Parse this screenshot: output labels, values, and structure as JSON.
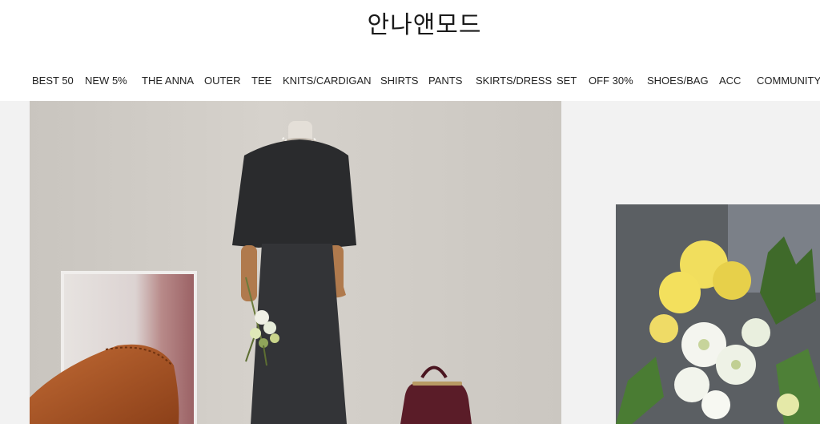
{
  "header": {
    "logo_text": "안나앤모드"
  },
  "nav": {
    "items": [
      {
        "label": "BEST 50",
        "name": "nav-item-best50"
      },
      {
        "label": "NEW 5%",
        "name": "nav-item-new5"
      },
      {
        "label": "THE ANNA",
        "name": "nav-item-the-anna"
      },
      {
        "label": "OUTER",
        "name": "nav-item-outer"
      },
      {
        "label": "TEE",
        "name": "nav-item-tee"
      },
      {
        "label": "KNITS/CARDIGAN",
        "name": "nav-item-knits-cardigan"
      },
      {
        "label": "SHIRTS",
        "name": "nav-item-shirts"
      },
      {
        "label": "PANTS",
        "name": "nav-item-pants"
      },
      {
        "label": "SKIRTS/DRESS",
        "name": "nav-item-skirts-dress"
      },
      {
        "label": "SET",
        "name": "nav-item-set"
      },
      {
        "label": "OFF 30%",
        "name": "nav-item-off30"
      },
      {
        "label": "SHOES/BAG",
        "name": "nav-item-shoes-bag"
      },
      {
        "label": "ACC",
        "name": "nav-item-acc"
      },
      {
        "label": "COMMUNITY",
        "name": "nav-item-community"
      }
    ]
  },
  "colors": {
    "background": "#f2f2f2",
    "text": "#222222"
  }
}
